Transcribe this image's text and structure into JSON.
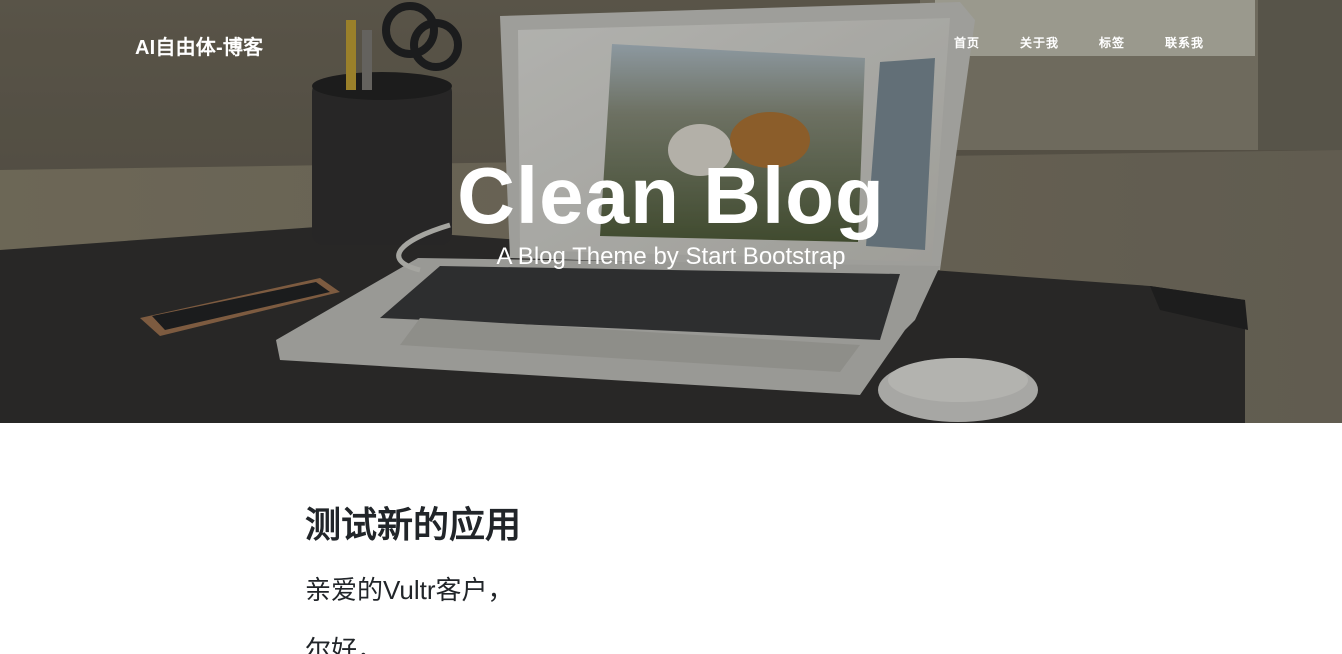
{
  "navbar": {
    "brand": "AI自由体-博客",
    "links": [
      "首页",
      "关于我",
      "标签",
      "联系我"
    ]
  },
  "hero": {
    "title": "Clean Blog",
    "subheading": "A Blog Theme by Start Bootstrap",
    "background_image": "desk-laptop-photo"
  },
  "post": {
    "title": "测试新的应用",
    "subtitle": "亲爱的Vultr客户，",
    "next_line": "尔好，"
  },
  "colors": {
    "hero_overlay": "#212529",
    "text": "#212529",
    "nav_text": "#ffffff"
  }
}
